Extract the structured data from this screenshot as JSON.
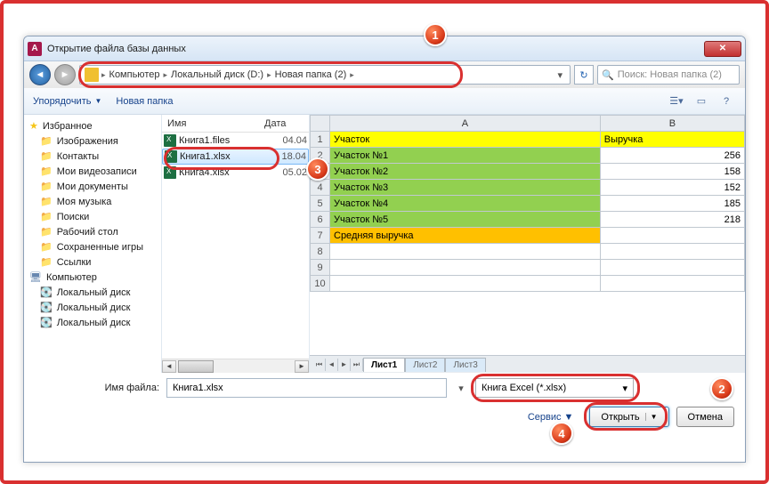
{
  "window": {
    "title": "Открытие файла базы данных",
    "app_icon_letter": "A"
  },
  "breadcrumb": {
    "parts": [
      "Компьютер",
      "Локальный диск (D:)",
      "Новая папка (2)"
    ]
  },
  "search": {
    "placeholder": "Поиск: Новая папка (2)"
  },
  "toolbar": {
    "organize": "Упорядочить",
    "newfolder": "Новая папка"
  },
  "sidebar": {
    "favorites": "Избранное",
    "items1": [
      "Изображения",
      "Контакты",
      "Мои видеозаписи",
      "Мои документы",
      "Моя музыка",
      "Поиски",
      "Рабочий стол",
      "Сохраненные игры",
      "Ссылки"
    ],
    "computer": "Компьютер",
    "drives": [
      "Локальный диск",
      "Локальный диск",
      "Локальный диск"
    ]
  },
  "filelist": {
    "cols": {
      "name": "Имя",
      "date": "Дата"
    },
    "rows": [
      {
        "name": "Книга1.files",
        "date": "04.04"
      },
      {
        "name": "Книга1.xlsx",
        "date": "18.04",
        "selected": true
      },
      {
        "name": "Книга4.xlsx",
        "date": "05.02"
      }
    ]
  },
  "chart_data": {
    "type": "table",
    "columns": [
      "A",
      "B"
    ],
    "headers": [
      "Участок",
      "Выручка"
    ],
    "rows": [
      {
        "label": "Участок №1",
        "value": 256
      },
      {
        "label": "Участок №2",
        "value": 158
      },
      {
        "label": "Участок №3",
        "value": 152
      },
      {
        "label": "Участок №4",
        "value": 185
      },
      {
        "label": "Участок №5",
        "value": 218
      }
    ],
    "summary_label": "Средняя выручка"
  },
  "sheets": [
    "Лист1",
    "Лист2",
    "Лист3"
  ],
  "bottom": {
    "fn_label": "Имя файла:",
    "fn_value": "Книга1.xlsx",
    "filetype": "Книга Excel (*.xlsx)",
    "service": "Сервис",
    "open": "Открыть",
    "cancel": "Отмена"
  },
  "badges": {
    "b1": "1",
    "b2": "2",
    "b3": "3",
    "b4": "4"
  }
}
